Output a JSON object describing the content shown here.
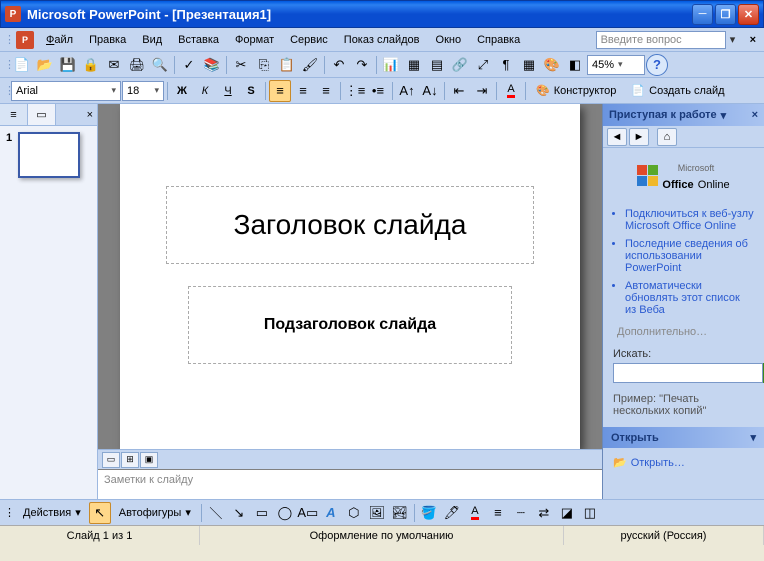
{
  "title": "Microsoft PowerPoint - [Презентация1]",
  "menu": {
    "file": "Файл",
    "edit": "Правка",
    "view": "Вид",
    "insert": "Вставка",
    "format": "Формат",
    "tools": "Сервис",
    "slideshow": "Показ слайдов",
    "window": "Окно",
    "help": "Справка"
  },
  "questionbox": {
    "placeholder": "Введите вопрос"
  },
  "zoom": "45%",
  "font": {
    "name": "Arial",
    "size": "18"
  },
  "fmtbar": {
    "designer": "Конструктор",
    "newslide": "Создать слайд"
  },
  "slide": {
    "title_ph": "Заголовок слайда",
    "sub_ph": "Подзаголовок слайда"
  },
  "thumbs": {
    "num1": "1"
  },
  "notes": {
    "placeholder": "Заметки к слайду"
  },
  "taskpane": {
    "title": "Приступая к работе",
    "office_prefix": "Microsoft",
    "office_brand": "Office",
    "office_suffix": "Online",
    "links": [
      "Подключиться к веб-узлу Microsoft Office Online",
      "Последние сведения об использовании PowerPoint",
      "Автоматически обновлять этот список из Веба"
    ],
    "more": "Дополнительно…",
    "search_label": "Искать:",
    "example_label": "Пример:",
    "example_text": "\"Печать нескольких копий\"",
    "open_hdr": "Открыть",
    "open_link": "Открыть…"
  },
  "drawbar": {
    "actions": "Действия",
    "autoshapes": "Автофигуры"
  },
  "status": {
    "slide": "Слайд 1 из 1",
    "design": "Оформление по умолчанию",
    "lang": "русский (Россия)"
  }
}
